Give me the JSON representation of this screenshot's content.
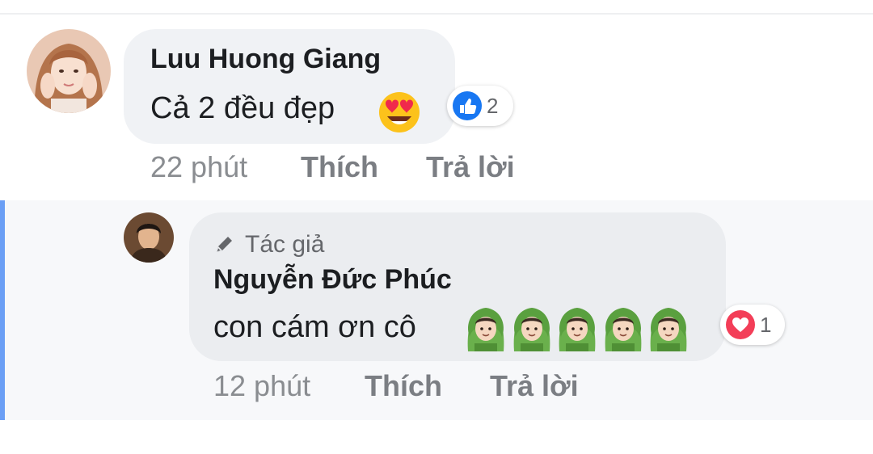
{
  "comment": {
    "author": "Luu Huong Giang",
    "text": "Cả 2 đều đẹp",
    "emoji_icon": "heart-eyes-emoji",
    "reaction": {
      "icon": "like-icon",
      "count": "2",
      "color": "#1877f2"
    },
    "time": "22 phút",
    "like_label": "Thích",
    "reply_label": "Trả lời"
  },
  "reply": {
    "author_badge": "Tác giả",
    "author": "Nguyễn Đức Phúc",
    "text": "con cám ơn cô",
    "emoji_icon": "person-heart-hands-emoji",
    "emoji_count": 5,
    "reaction": {
      "icon": "heart-reaction-icon",
      "count": "1",
      "color": "#f33e58"
    },
    "time": "12 phút",
    "like_label": "Thích",
    "reply_label": "Trả lời"
  },
  "colors": {
    "bubble": "#f0f2f5",
    "reply_bar": "#6b9ff5",
    "meta_text": "#8a8d91"
  }
}
